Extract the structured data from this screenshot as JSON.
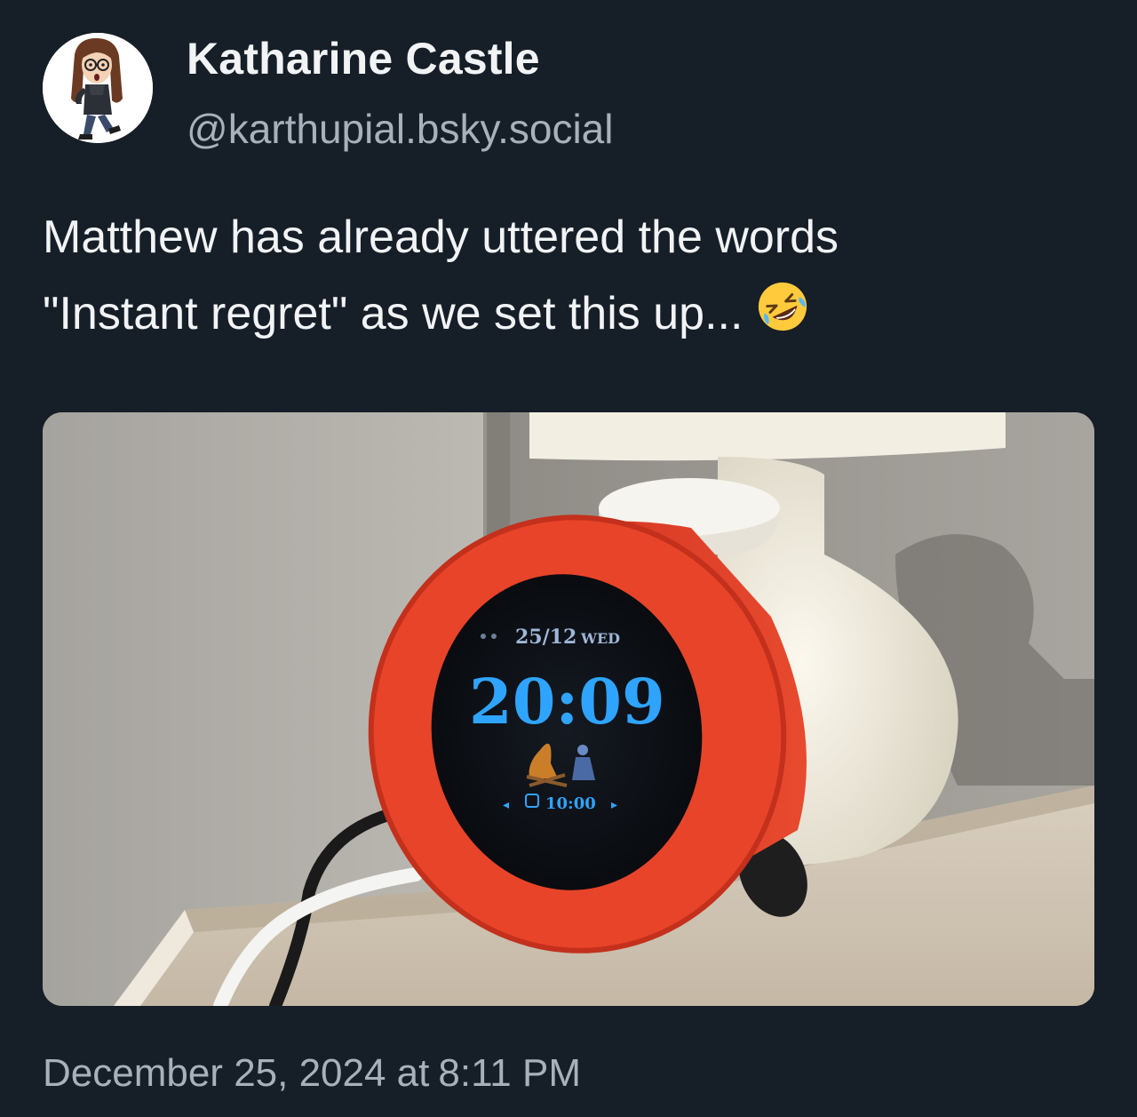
{
  "author": {
    "display_name": "Katharine Castle",
    "handle": "@karthupial.bsky.social"
  },
  "post": {
    "text_line1": "Matthew has already uttered the words",
    "text_line2": "\"Instant regret\" as we set this up...",
    "emoji": "rolling-on-the-floor-laughing-emoji"
  },
  "media": {
    "clock_date": "25/12",
    "clock_day": "WED",
    "clock_time": "20:09",
    "clock_alarm": "10:00"
  },
  "timestamp": {
    "date": "December 25, 2024 at",
    "time": "8:11 PM"
  },
  "colors": {
    "background": "#161e27",
    "primary_text": "#f1f3f5",
    "secondary_text": "#a7b1bc",
    "clock_body": "#e23c25",
    "clock_digits": "#2fa4ff"
  }
}
